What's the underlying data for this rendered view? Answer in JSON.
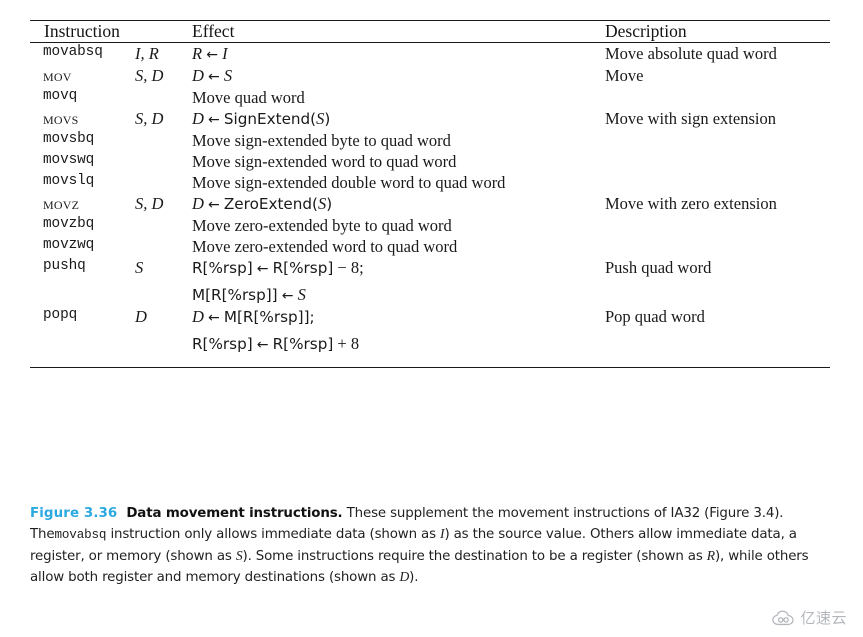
{
  "table": {
    "headers": {
      "instruction": "Instruction",
      "effect": "Effect",
      "description": "Description"
    },
    "rows": [
      {
        "instruction": "movabsq",
        "operands": "I, R",
        "effect_lines": [
          "R ← I"
        ],
        "description": "Move absolute quad word"
      },
      {
        "instruction": "MOV",
        "operands": "S, D",
        "effect_lines": [
          "D ← S"
        ],
        "description": "Move"
      },
      {
        "instruction": "movq",
        "operands": "",
        "effect_lines": [
          "Move quad word"
        ],
        "description": ""
      },
      {
        "instruction": "MOVS",
        "operands": "S, D",
        "effect_lines": [
          "D ← SignExtend(S)"
        ],
        "description": "Move with sign extension"
      },
      {
        "instruction": "movsbq",
        "operands": "",
        "effect_lines": [
          "Move sign-extended byte to quad word"
        ],
        "description": ""
      },
      {
        "instruction": "movswq",
        "operands": "",
        "effect_lines": [
          "Move sign-extended word to quad word"
        ],
        "description": ""
      },
      {
        "instruction": "movslq",
        "operands": "",
        "effect_lines": [
          "Move sign-extended double word to quad word"
        ],
        "description": ""
      },
      {
        "instruction": "MOVZ",
        "operands": "S, D",
        "effect_lines": [
          "D ← ZeroExtend(S)"
        ],
        "description": "Move with zero extension"
      },
      {
        "instruction": "movzbq",
        "operands": "",
        "effect_lines": [
          "Move zero-extended byte to quad word"
        ],
        "description": ""
      },
      {
        "instruction": "movzwq",
        "operands": "",
        "effect_lines": [
          "Move zero-extended word to quad word"
        ],
        "description": ""
      },
      {
        "instruction": "pushq",
        "operands": "S",
        "effect_lines": [
          "R[%rsp] ← R[%rsp] − 8;",
          "M[R[%rsp]] ← S"
        ],
        "description": "Push quad word"
      },
      {
        "instruction": "popq",
        "operands": "D",
        "effect_lines": [
          "D ← M[R[%rsp]];",
          "R[%rsp] ← R[%rsp] + 8"
        ],
        "description": "Pop quad word"
      }
    ]
  },
  "caption": {
    "figure_number": "Figure 3.36",
    "title": "Data movement instructions.",
    "body_1": "These supplement the movement instructions of IA32 (Figure 3.4). The",
    "mono_1": "movabsq",
    "body_2": "instruction only allows immediate data (shown as",
    "ital_1": "I",
    "body_3": ") as the source value. Others allow immediate data, a register, or memory (shown as",
    "ital_2": "S",
    "body_4": "). Some instructions require the destination to be a register (shown as",
    "ital_3": "R",
    "body_5": "), while others allow both register and memory destinations (shown as",
    "ital_4": "D",
    "body_6": ")."
  },
  "watermark": {
    "text": "亿速云",
    "icon": "cloud-logo-icon",
    "color": "#9a9fa6"
  },
  "colors": {
    "figure_number": "#2BA9E0",
    "rule": "#1a1a1a",
    "text": "#1a1a1a",
    "background": "#ffffff"
  }
}
